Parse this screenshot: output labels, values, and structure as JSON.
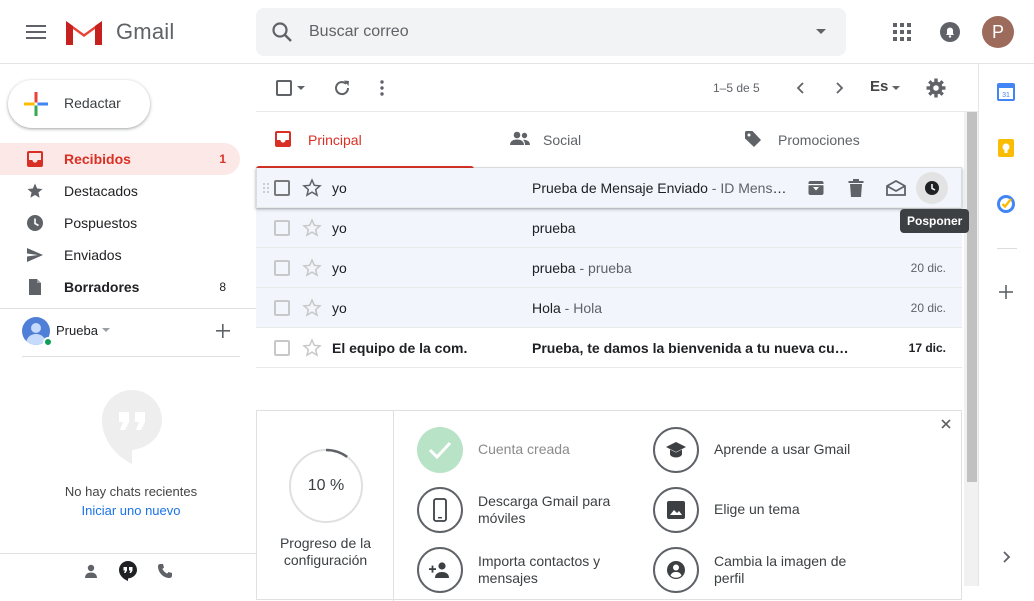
{
  "header": {
    "app_name": "Gmail",
    "search_placeholder": "Buscar correo",
    "avatar_initial": "P"
  },
  "sidebar": {
    "compose_label": "Redactar",
    "items": [
      {
        "label": "Recibidos",
        "count": "1",
        "icon": "inbox-icon",
        "active": true
      },
      {
        "label": "Destacados",
        "count": "",
        "icon": "star-icon"
      },
      {
        "label": "Pospuestos",
        "count": "",
        "icon": "clock-icon"
      },
      {
        "label": "Enviados",
        "count": "",
        "icon": "send-icon"
      },
      {
        "label": "Borradores",
        "count": "8",
        "icon": "draft-icon",
        "bold": true
      }
    ]
  },
  "hangouts": {
    "user_name": "Prueba",
    "no_chats": "No hay chats recientes",
    "start_new": "Iniciar uno nuevo"
  },
  "toolbar": {
    "range": "1–5 de 5",
    "language": "Es"
  },
  "tabs": [
    {
      "label": "Principal",
      "active": true
    },
    {
      "label": "Social"
    },
    {
      "label": "Promociones"
    }
  ],
  "emails": [
    {
      "sender": "yo",
      "subject": "Prueba de Mensaje Enviado",
      "snippet": " - ID Mensaje",
      "date": "",
      "unread": false,
      "hover": true
    },
    {
      "sender": "yo",
      "subject": "prueba",
      "snippet": "",
      "date": "",
      "unread": false
    },
    {
      "sender": "yo",
      "subject": "prueba",
      "snippet": " - prueba",
      "date": "20 dic.",
      "unread": false
    },
    {
      "sender": "yo",
      "subject": "Hola",
      "snippet": " - Hola",
      "date": "20 dic.",
      "unread": false
    },
    {
      "sender": "El equipo de la com.",
      "subject": "Prueba, te damos la bienvenida a tu nueva cuenta",
      "snippet": "",
      "date": "17 dic.",
      "unread": true
    }
  ],
  "tooltip": "Posponer",
  "setup": {
    "progress_pct": "10 %",
    "progress": 0.1,
    "progress_label": "Progreso de la configuración",
    "tasks": {
      "account_created": "Cuenta creada",
      "learn_gmail": "Aprende a usar Gmail",
      "download_app": "Descarga Gmail para móviles",
      "choose_theme": "Elige un tema",
      "import_contacts": "Importa contactos y mensajes",
      "change_photo": "Cambia la imagen de perfil"
    }
  },
  "colors": {
    "accent_red": "#d93025",
    "active_bg": "#fce8e6",
    "read_row_bg": "#f2f6fc",
    "link_blue": "#1a73e8"
  }
}
